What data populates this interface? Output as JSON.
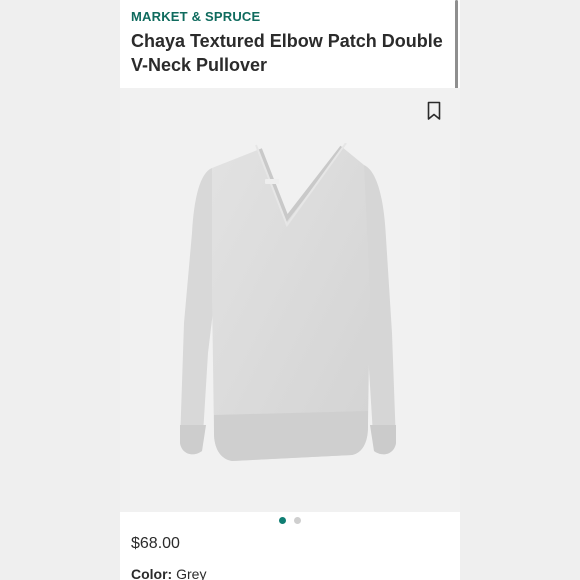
{
  "product": {
    "brand": "MARKET & SPRUCE",
    "title": "Chaya Textured Elbow Patch Double V-Neck Pullover",
    "price": "$68.00",
    "color_label": "Color:",
    "color_value": "Grey",
    "image_alt": "Grey v-neck pullover sweater"
  },
  "carousel": {
    "total": 2,
    "active_index": 0
  },
  "icons": {
    "bookmark": "bookmark-icon"
  },
  "colors": {
    "brand_green": "#0f6b5e",
    "active_dot": "#0f7e73",
    "sweater": "#dcdcdc"
  }
}
